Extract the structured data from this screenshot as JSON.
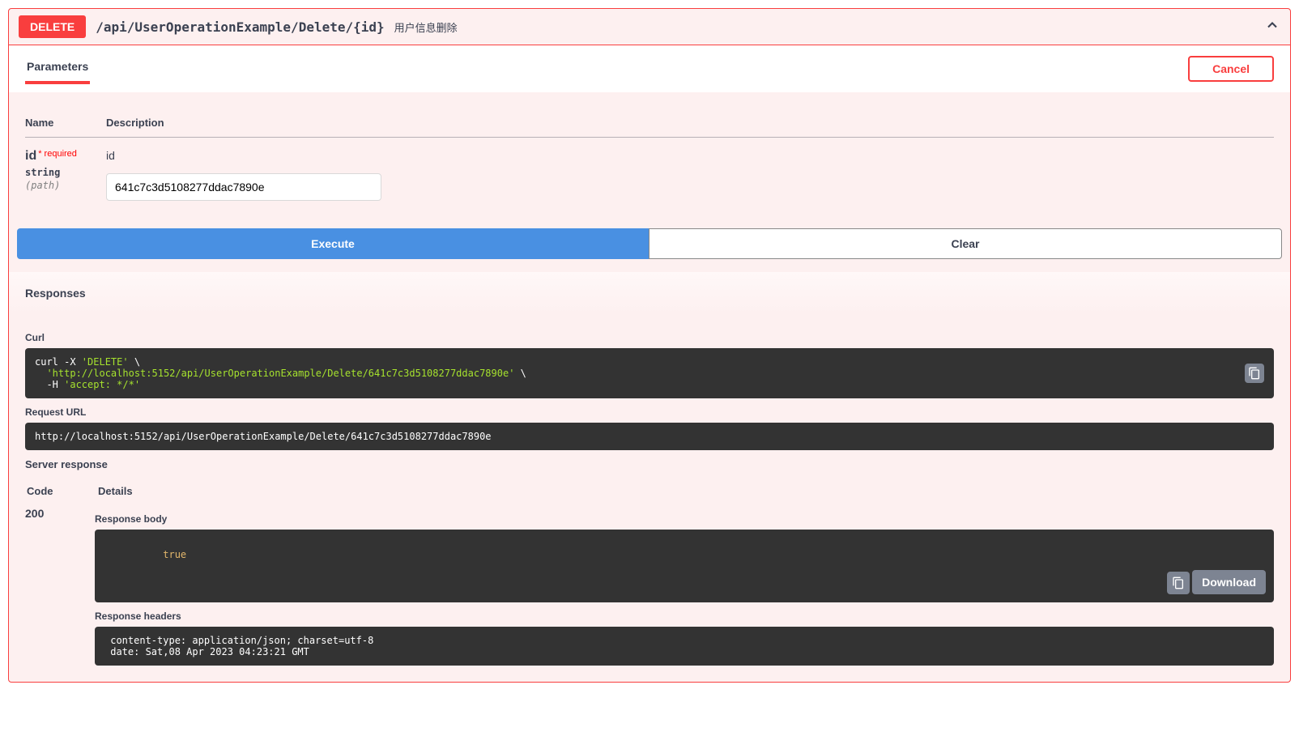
{
  "operation": {
    "method": "DELETE",
    "path": "/api/UserOperationExample/Delete/{id}",
    "summary": "用户信息删除"
  },
  "tabs": {
    "parameters": "Parameters",
    "cancel": "Cancel"
  },
  "tableHeaders": {
    "name": "Name",
    "description": "Description"
  },
  "param": {
    "name": "id",
    "required": "* required",
    "type": "string",
    "in": "(path)",
    "desc": "id",
    "value": "641c7c3d5108277ddac7890e"
  },
  "buttons": {
    "execute": "Execute",
    "clear": "Clear",
    "download": "Download"
  },
  "sections": {
    "responses": "Responses",
    "curl": "Curl",
    "requestUrl": "Request URL",
    "serverResponse": "Server response",
    "code": "Code",
    "details": "Details",
    "responseBody": "Response body",
    "responseHeaders": "Response headers"
  },
  "curl": {
    "line1a": "curl -X ",
    "line1b": "'DELETE'",
    "line1c": " \\",
    "line2a": "  ",
    "line2b": "'http://localhost:5152/api/UserOperationExample/Delete/641c7c3d5108277ddac7890e'",
    "line2c": " \\",
    "line3a": "  -H ",
    "line3b": "'accept: */*'"
  },
  "requestUrl": "http://localhost:5152/api/UserOperationExample/Delete/641c7c3d5108277ddac7890e",
  "response": {
    "code": "200",
    "body": "true",
    "headers": " content-type: application/json; charset=utf-8 \n date: Sat,08 Apr 2023 04:23:21 GMT "
  }
}
